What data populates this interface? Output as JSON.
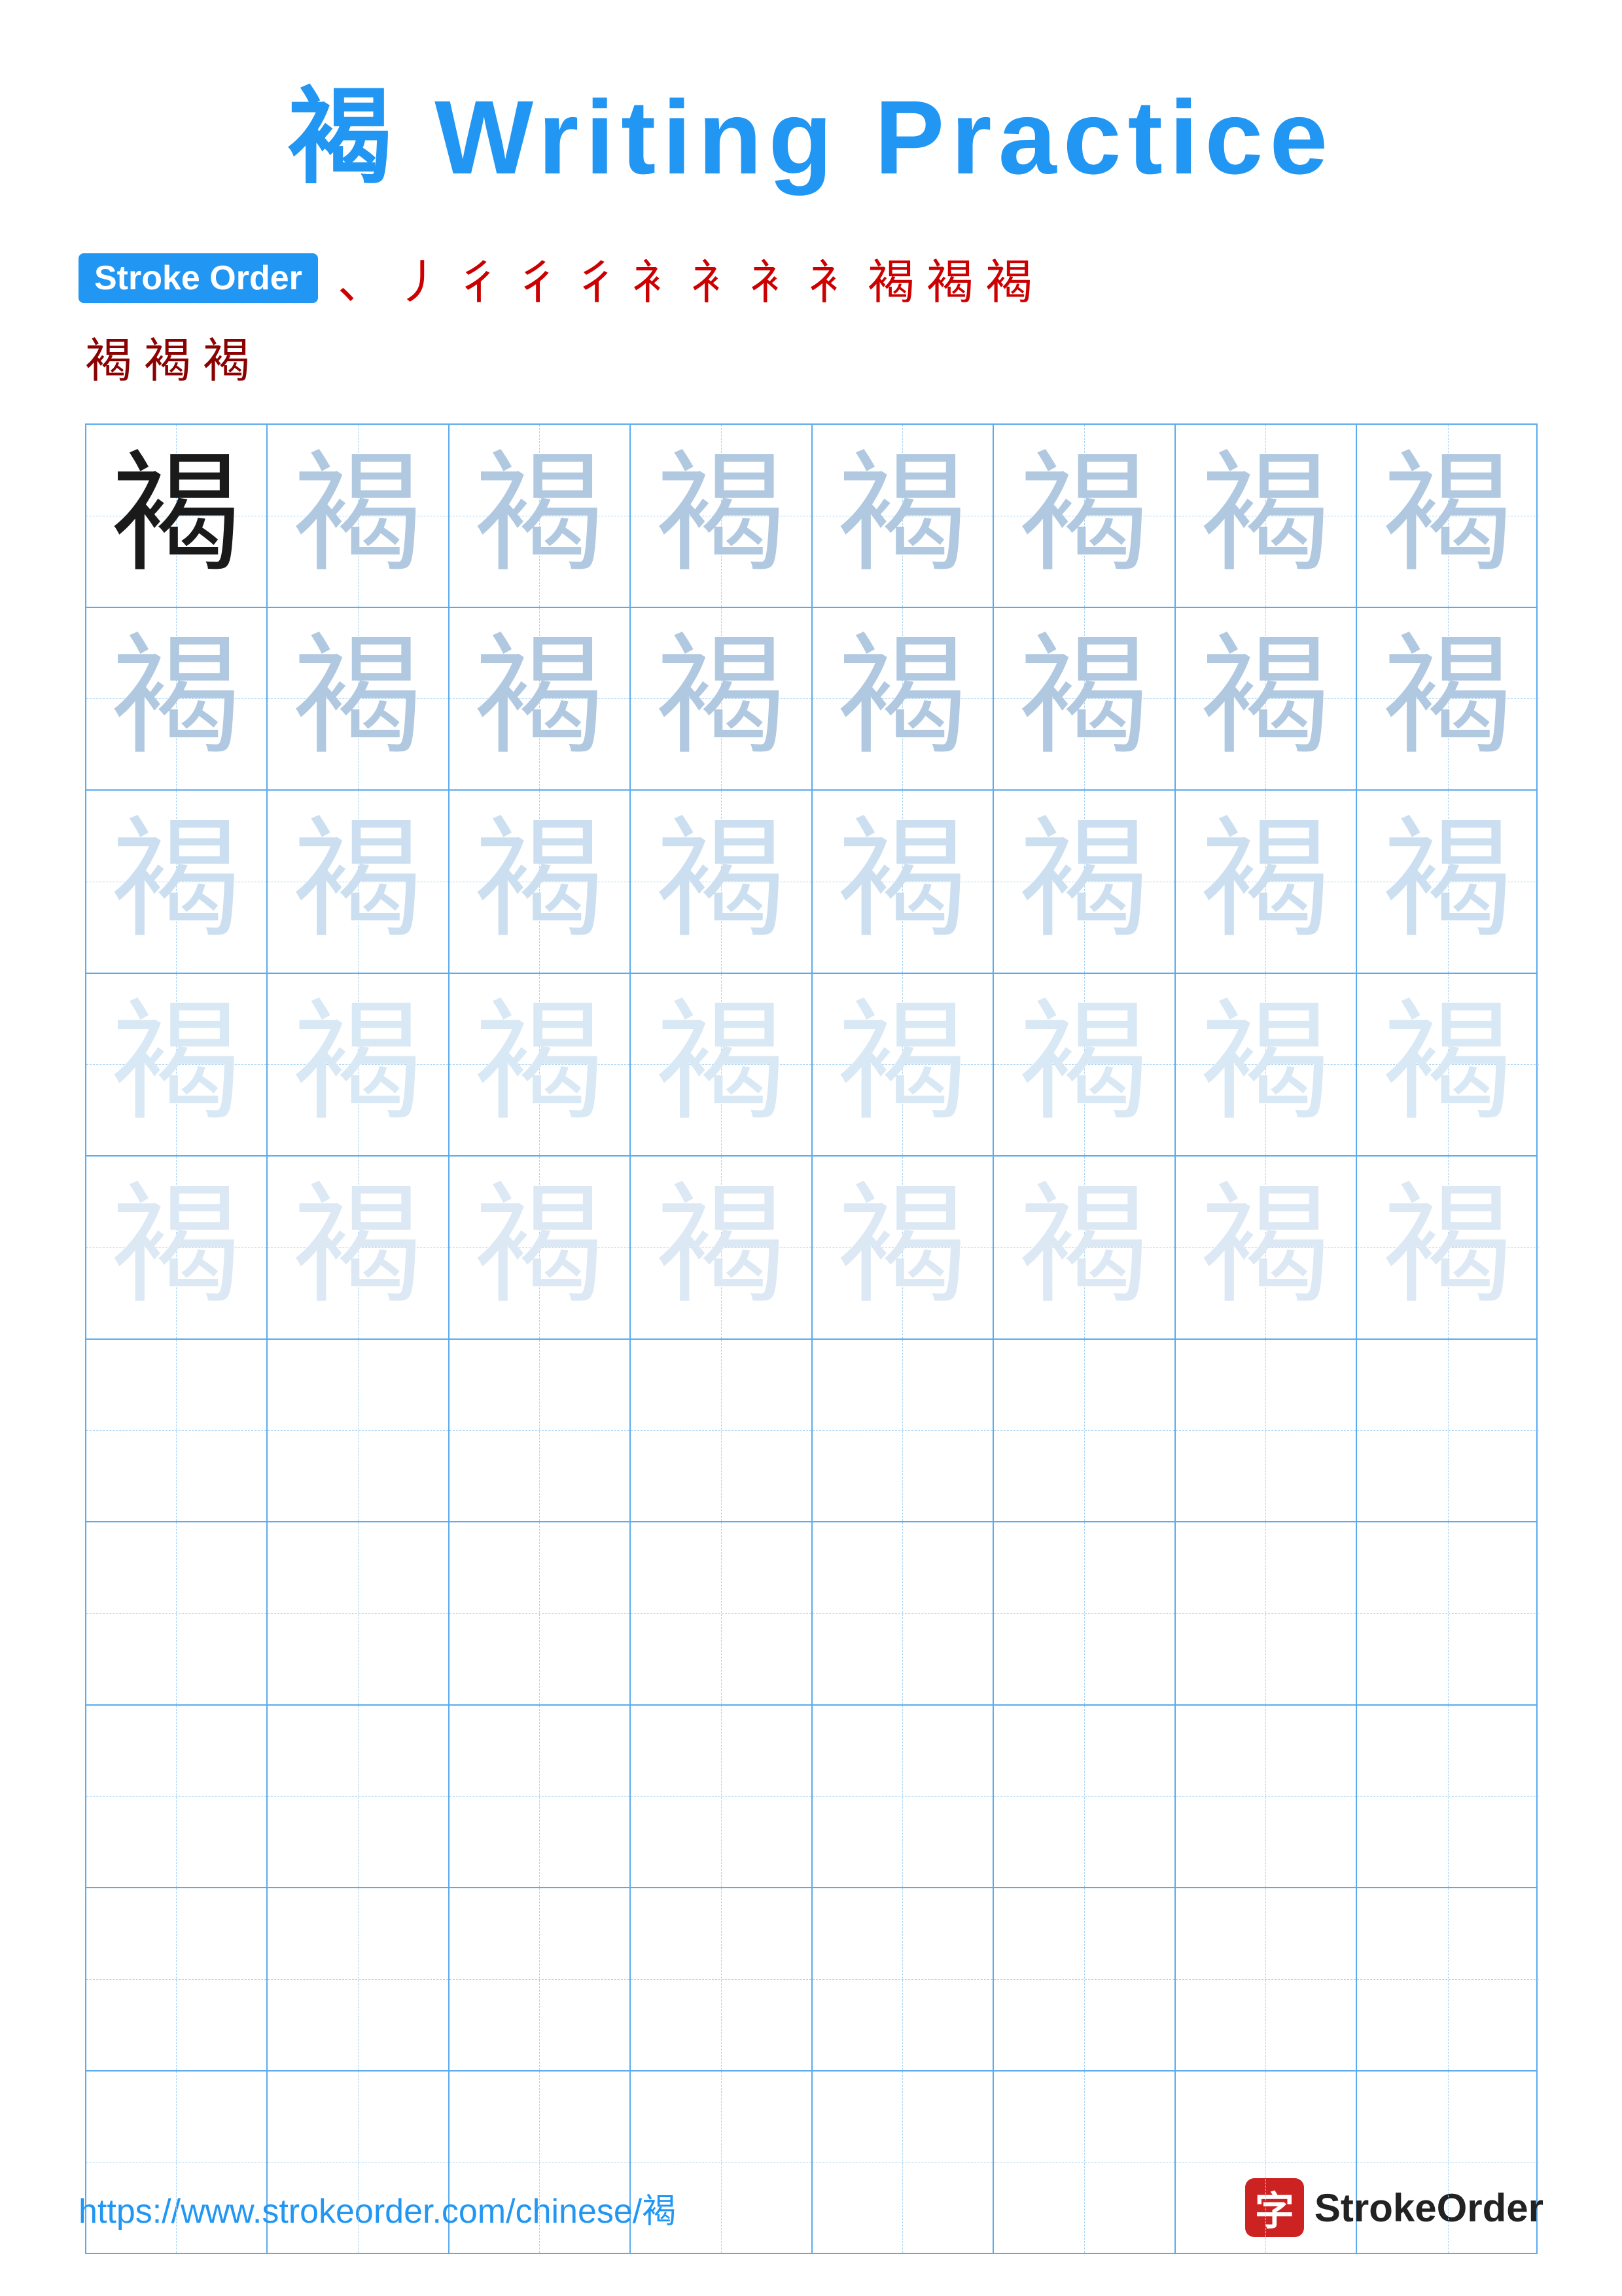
{
  "title": {
    "char": "褐",
    "text": " Writing Practice",
    "full": "褐 Writing Practice"
  },
  "stroke_order": {
    "badge_label": "Stroke Order",
    "strokes_row1": [
      "、",
      "丿",
      "彳",
      "彳",
      "彳",
      "彳",
      "衤",
      "衤",
      "衤",
      "衤",
      "褐",
      "褐"
    ],
    "strokes_row2": [
      "褐",
      "褐",
      "褐"
    ]
  },
  "grid": {
    "rows": 10,
    "cols": 8,
    "char": "褐",
    "filled_rows": 5
  },
  "footer": {
    "url": "https://www.strokeorder.com/chinese/褐",
    "logo_char": "字",
    "logo_text": "StrokeOrder"
  }
}
